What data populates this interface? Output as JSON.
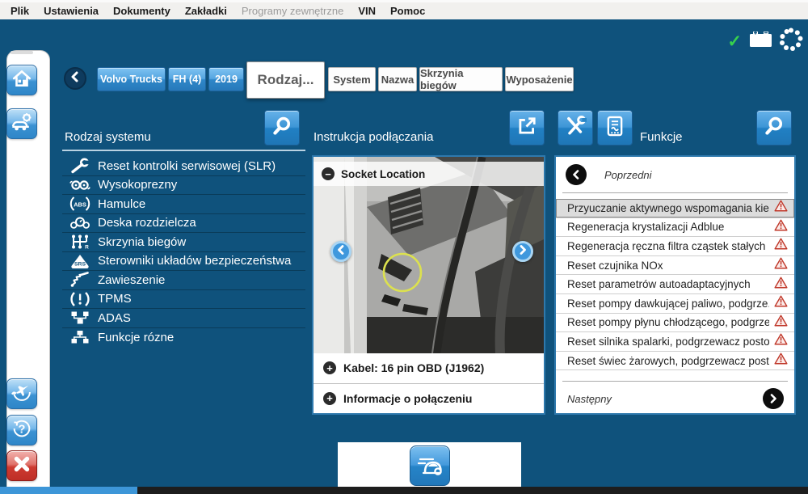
{
  "menubar": {
    "items": [
      {
        "label": "Plik",
        "enabled": true
      },
      {
        "label": "Ustawienia",
        "enabled": true
      },
      {
        "label": "Dokumenty",
        "enabled": true
      },
      {
        "label": "Zakładki",
        "enabled": true
      },
      {
        "label": "Programy zewnętrzne",
        "enabled": false
      },
      {
        "label": "VIN",
        "enabled": true
      },
      {
        "label": "Pomoc",
        "enabled": true
      }
    ]
  },
  "statusbar": {
    "connection_icon": "green-check",
    "battery_icon": "battery-icon",
    "busy_icon": "spinner-dots-icon"
  },
  "topnav": {
    "back_icon": "back-arrow-icon",
    "vehicle_buttons": [
      {
        "label": "Volvo Trucks"
      },
      {
        "label": "FH (4)"
      },
      {
        "label": "2019"
      }
    ],
    "active_tab": {
      "label": "Rodzaj..."
    },
    "tabs": [
      {
        "label": "System"
      },
      {
        "label": "Nazwa"
      },
      {
        "label": "Skrzynia biegów"
      },
      {
        "label": "Wyposażenie"
      }
    ]
  },
  "sidebar": {
    "top_buttons": [
      {
        "icon": "home-icon"
      },
      {
        "icon": "vehicle-diagnostics-icon"
      }
    ],
    "bottom_buttons": [
      {
        "icon": "airplane-icon"
      },
      {
        "icon": "help-icon"
      },
      {
        "icon": "close-icon"
      }
    ]
  },
  "system_panel": {
    "title": "Rodzaj systemu",
    "search_icon": "search-icon",
    "items": [
      {
        "icon": "service-wrench-icon",
        "label": "Reset kontrolki serwisowej (SLR)"
      },
      {
        "icon": "engine-icon",
        "label": "Wysokoprezny"
      },
      {
        "icon": "abs-brakes-icon",
        "label": "Hamulce"
      },
      {
        "icon": "dashboard-icon",
        "label": "Deska rozdzielcza"
      },
      {
        "icon": "gearbox-icon",
        "label": "Skrzynia biegów"
      },
      {
        "icon": "srs-icon",
        "label": "Sterowniki układów bezpieczeństwa"
      },
      {
        "icon": "suspension-icon",
        "label": "Zawieszenie"
      },
      {
        "icon": "tpms-icon",
        "label": "TPMS"
      },
      {
        "icon": "adas-icon",
        "label": "ADAS"
      },
      {
        "icon": "misc-functions-icon",
        "label": "Funkcje rózne"
      }
    ]
  },
  "connection_panel": {
    "title": "Instrukcja podłączania",
    "external_icon": "external-link-icon",
    "image_caption": "Socket Location",
    "collapse_glyph": "−",
    "expand_glyph": "+",
    "accordions": [
      {
        "label": "Kabel: 16 pin OBD (J1962)"
      },
      {
        "label": "Informacje o połączeniu"
      }
    ]
  },
  "functions_panel": {
    "title": "Funkcje",
    "toolbar_icons": [
      {
        "icon": "tools-icon"
      },
      {
        "icon": "procedures-icon"
      }
    ],
    "search_icon": "search-icon",
    "previous_label": "Poprzedni",
    "next_label": "Następny",
    "items": [
      {
        "label": "Przyuczanie aktywnego wspomagania kier...",
        "warning": true,
        "selected": true
      },
      {
        "label": "Regeneracja krystalizacji Adblue",
        "warning": true,
        "selected": false
      },
      {
        "label": "Regeneracja ręczna filtra cząstek stałych",
        "warning": true,
        "selected": false
      },
      {
        "label": "Reset czujnika NOx",
        "warning": true,
        "selected": false
      },
      {
        "label": "Reset parametrów autoadaptacyjnych",
        "warning": true,
        "selected": false
      },
      {
        "label": "Reset pompy dawkującej paliwo, podgrze...",
        "warning": true,
        "selected": false
      },
      {
        "label": "Reset pompy płynu chłodzącego, podgrze...",
        "warning": true,
        "selected": false
      },
      {
        "label": "Reset silnika spalarki, podgrzewacz postoj...",
        "warning": true,
        "selected": false
      },
      {
        "label": "Reset świec żarowych, podgrzewacz posto...",
        "warning": true,
        "selected": false
      }
    ]
  },
  "bottom_drawer": {
    "icon": "vehicle-icon"
  },
  "colors": {
    "background": "#0f527c",
    "accent_blue": "#2e86c8",
    "warning_red": "#c0392b",
    "highlight_yellow": "#dce14e",
    "success_green": "#37d24d"
  }
}
